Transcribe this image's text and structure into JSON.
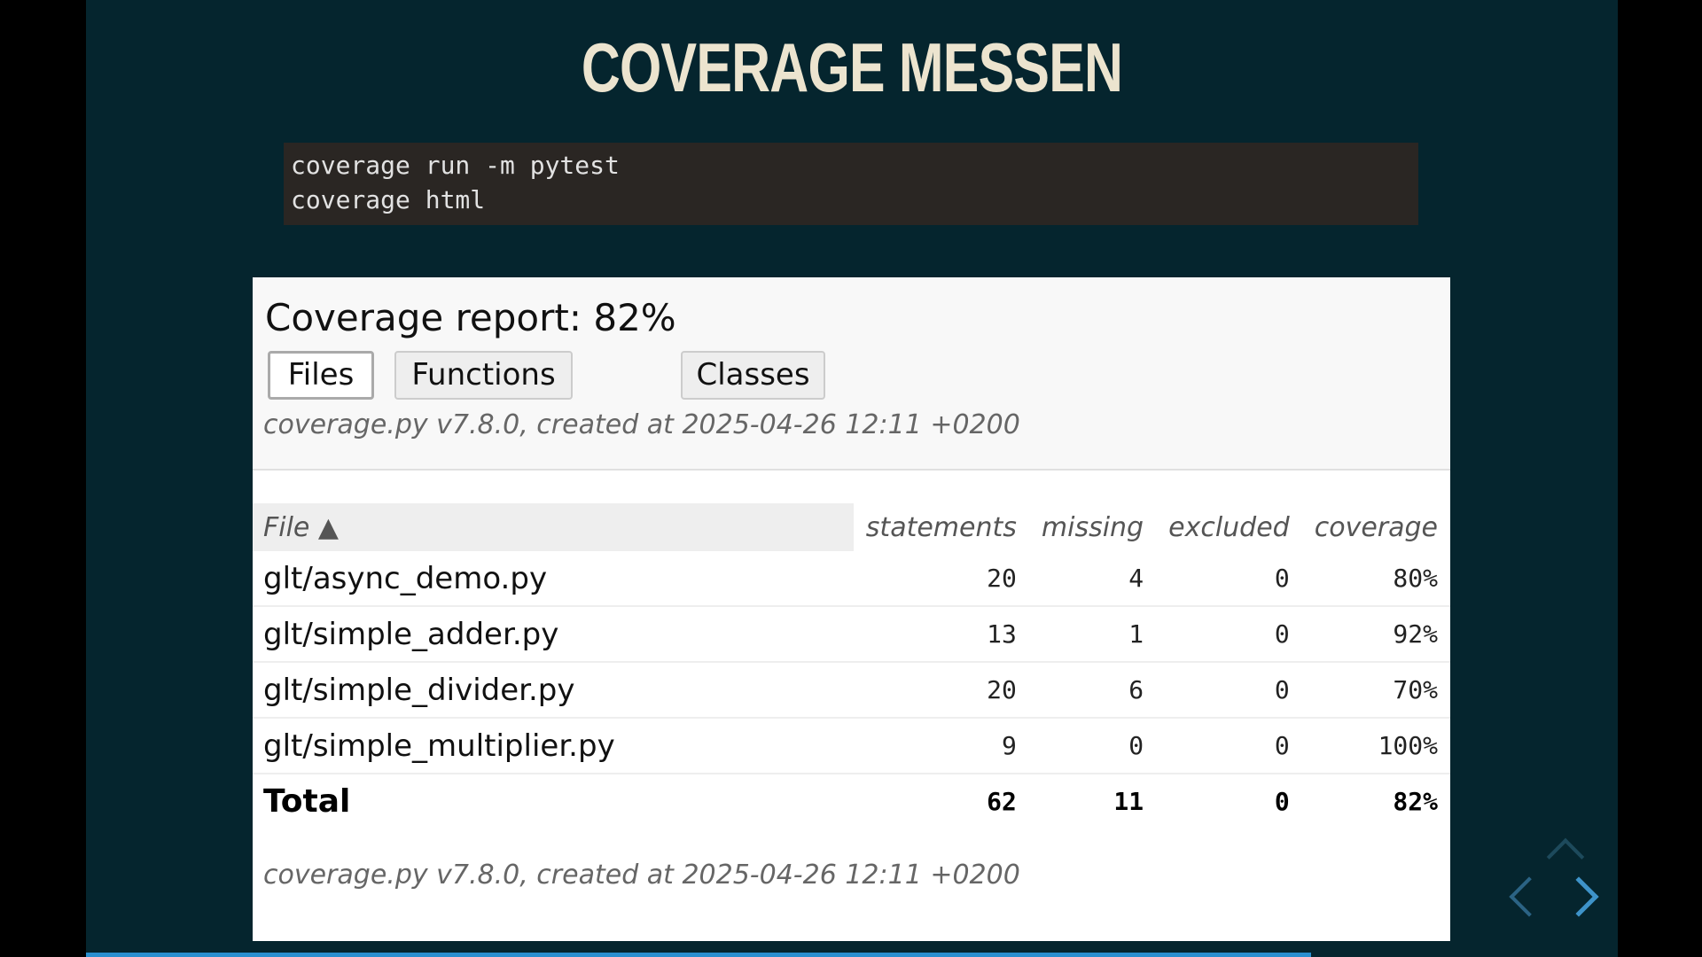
{
  "slide": {
    "title": "COVERAGE MESSEN",
    "background": "#05252e",
    "progress": 0.8
  },
  "code": {
    "lines": [
      "coverage run -m pytest",
      "coverage html"
    ]
  },
  "report": {
    "title": "Coverage report: 82%",
    "tabs": [
      {
        "label": "Files",
        "active": true
      },
      {
        "label": "Functions",
        "active": false
      },
      {
        "label": "Classes",
        "active": false
      }
    ],
    "meta_top": "coverage.py v7.8.0, created at 2025-04-26 12:11 +0200",
    "meta_bottom": "coverage.py v7.8.0, created at 2025-04-26 12:11 +0200",
    "columns": {
      "file": "File ▲",
      "statements": "statements",
      "missing": "missing",
      "excluded": "excluded",
      "coverage": "coverage"
    },
    "rows": [
      {
        "file": "glt/async_demo.py",
        "statements": "20",
        "missing": "4",
        "excluded": "0",
        "coverage": "80%"
      },
      {
        "file": "glt/simple_adder.py",
        "statements": "13",
        "missing": "1",
        "excluded": "0",
        "coverage": "92%"
      },
      {
        "file": "glt/simple_divider.py",
        "statements": "20",
        "missing": "6",
        "excluded": "0",
        "coverage": "70%"
      },
      {
        "file": "glt/simple_multiplier.py",
        "statements": "9",
        "missing": "0",
        "excluded": "0",
        "coverage": "100%"
      }
    ],
    "total": {
      "file": "Total",
      "statements": "62",
      "missing": "11",
      "excluded": "0",
      "coverage": "82%"
    }
  },
  "navigation": {
    "icons": [
      "chevron-up-icon",
      "chevron-left-icon",
      "chevron-right-icon"
    ]
  }
}
